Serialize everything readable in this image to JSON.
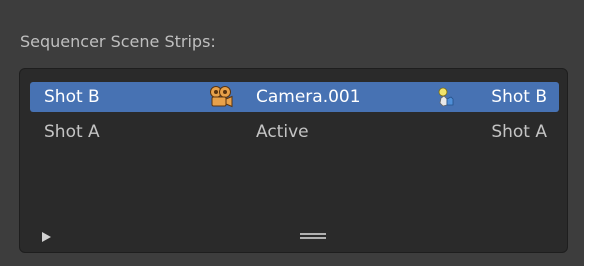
{
  "panel": {
    "label": "Sequencer Scene Strips:"
  },
  "strips": [
    {
      "name": "Shot B",
      "camera_icon": "camera-object-icon",
      "camera": "Camera.001",
      "scene_icon": "scene-icon",
      "scene": "Shot B",
      "selected": true
    },
    {
      "name": "Shot A",
      "camera": "Active",
      "scene": "Shot A",
      "selected": false
    }
  ],
  "colors": {
    "panel_bg": "#3d3d3d",
    "list_bg": "#2a2a2a",
    "selection": "#4772b3"
  }
}
